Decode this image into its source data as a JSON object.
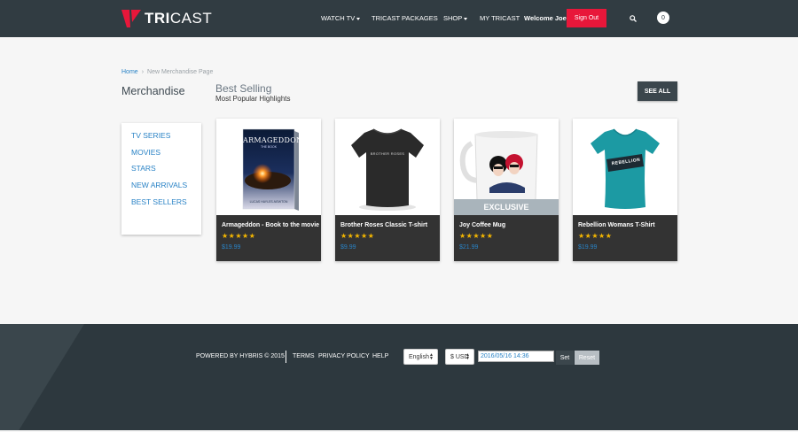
{
  "header": {
    "brand": {
      "part1": "TRI",
      "part2": "CAST"
    },
    "nav": [
      {
        "label": "WATCH TV"
      },
      {
        "label": "TRICAST PACKAGES"
      },
      {
        "label": "SHOP"
      },
      {
        "label": "MY TRICAST"
      }
    ],
    "welcome": "Welcome Joe",
    "signout_label": "Sign Out",
    "search_icon": "search-icon",
    "cart_count": "0"
  },
  "breadcrumb": {
    "home": "Home",
    "current": "New Merchandise Page"
  },
  "page_title": "Merchandise",
  "section": {
    "title": "Best Selling",
    "subtitle": "Most Popular Highlights",
    "see_all": "SEE ALL"
  },
  "sidebar": {
    "items": [
      {
        "label": "TV SERIES"
      },
      {
        "label": "MOVIES"
      },
      {
        "label": "STARS"
      },
      {
        "label": "NEW ARRIVALS"
      },
      {
        "label": "BEST SELLERS"
      }
    ]
  },
  "products": [
    {
      "name": "Armageddon - Book to the movie",
      "stars": "★★★★★",
      "price": "$19.99",
      "image": "book-cover"
    },
    {
      "name": "Brother Roses Classic T-shirt",
      "stars": "★★★★★",
      "price": "$9.99",
      "image": "black-tshirt"
    },
    {
      "name": "Joy Coffee Mug",
      "stars": "★★★★★",
      "price": "$21.99",
      "image": "coffee-mug",
      "badge": "EXCLUSIVE"
    },
    {
      "name": "Rebellion Womans T-Shirt",
      "stars": "★★★★★",
      "price": "$19.99",
      "image": "teal-tshirt"
    }
  ],
  "book": {
    "title": "ARMAGEDDON",
    "subtitle": "THE BOOK",
    "author": "LUCAS HAYLES-NEWTON"
  },
  "tshirt_text": {
    "black": "BROTHER ROSES",
    "teal": "REBELLION"
  },
  "footer": {
    "powered": "POWERED BY HYBRIS © 2015",
    "links": [
      {
        "label": "TERMS"
      },
      {
        "label": "PRIVACY POLICY"
      },
      {
        "label": "HELP"
      }
    ],
    "language": "English",
    "currency": "$ USD",
    "datetime": "2016/05/16 14:36",
    "set_label": "Set",
    "reset_label": "Reset"
  },
  "colors": {
    "header_bg": "#313c42",
    "accent_red": "#e8173a",
    "link_blue": "#2a83c6",
    "star_gold": "#f5b700",
    "card_info_bg": "#333333",
    "footer_bg": "#2d383e"
  }
}
